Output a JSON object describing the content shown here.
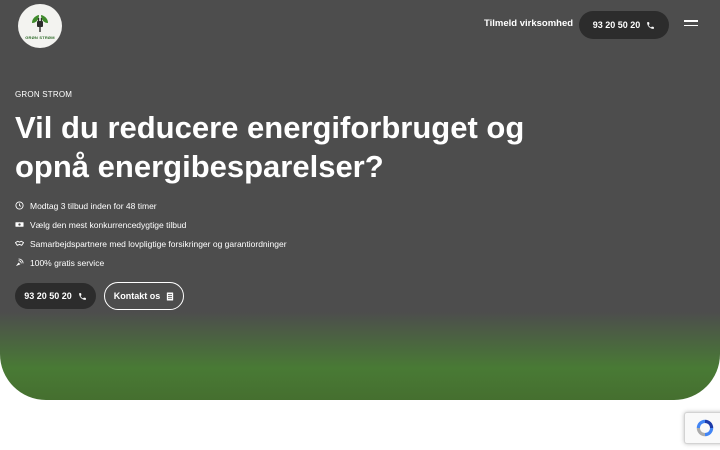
{
  "header": {
    "logo_text": "GRØN STRØM",
    "nav_link": "Tilmeld virksomhed",
    "phone": "93 20 50 20"
  },
  "hero": {
    "eyebrow": "GRON STROM",
    "headline": "Vil du reducere energiforbruget og opnå energibesparelser?",
    "features": [
      {
        "icon": "clock-icon",
        "text": "Modtag 3 tilbud inden for 48 timer"
      },
      {
        "icon": "money-icon",
        "text": "Vælg den mest konkurrencedygtige tilbud"
      },
      {
        "icon": "handshake-icon",
        "text": "Samarbejdspartnere med lovpligtige forsikringer og garantiordninger"
      },
      {
        "icon": "satellite-icon",
        "text": "100% gratis service"
      }
    ],
    "phone_button": "93 20 50 20",
    "contact_button": "Kontakt os"
  },
  "colors": {
    "hero_gray": "#4d4d4d",
    "hero_green": "#456f2f",
    "button_dark": "#2c2c2c"
  }
}
